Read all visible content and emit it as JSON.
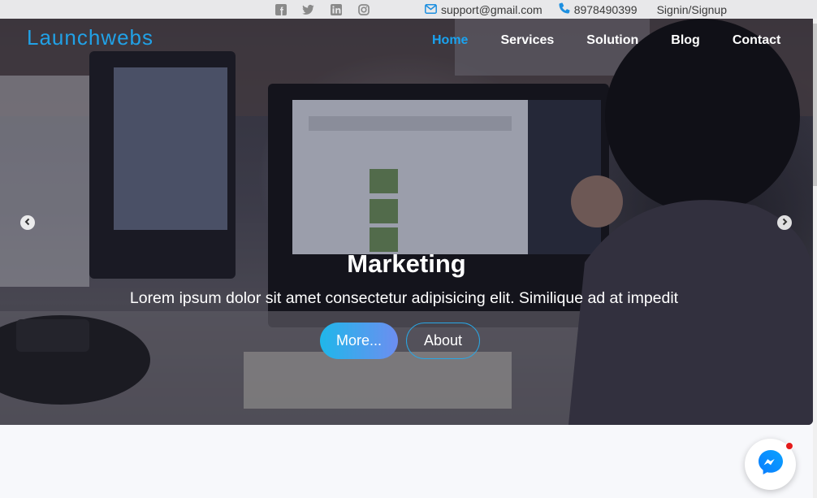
{
  "topbar": {
    "social_icons": [
      "facebook-icon",
      "twitter-icon",
      "linkedin-icon",
      "instagram-icon"
    ],
    "email": "support@gmail.com",
    "phone": "8978490399",
    "signin": "Signin/Signup"
  },
  "header": {
    "brand": "Launchwebs",
    "nav": [
      {
        "label": "Home",
        "active": true
      },
      {
        "label": "Services",
        "active": false
      },
      {
        "label": "Solution",
        "active": false
      },
      {
        "label": "Blog",
        "active": false
      },
      {
        "label": "Contact",
        "active": false
      }
    ]
  },
  "hero": {
    "title": "Marketing",
    "text": "Lorem ipsum dolor sit amet consectetur adipisicing elit. Similique ad at impedit",
    "primary_button": "More...",
    "secondary_button": "About"
  },
  "colors": {
    "accent": "#1aa3f0",
    "brand": "#21a1e6",
    "topbar_bg": "#e8e8ea",
    "notification": "#e41b1b"
  }
}
